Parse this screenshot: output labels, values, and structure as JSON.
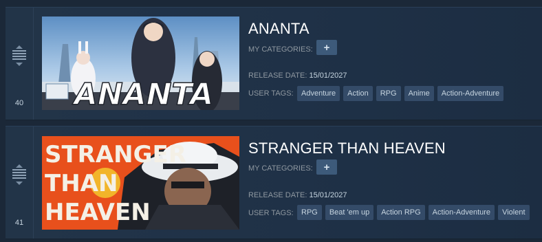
{
  "games": [
    {
      "rank": "40",
      "title": "ANANTA",
      "categories_label": "MY CATEGORIES:",
      "add_category_label": "+",
      "release_label": "RELEASE DATE:",
      "release_date": "15/01/2027",
      "tags_label": "USER TAGS:",
      "tags": [
        "Adventure",
        "Action",
        "RPG",
        "Anime",
        "Action-Adventure"
      ],
      "art_text": "ANANTA"
    },
    {
      "rank": "41",
      "title": "STRANGER THAN HEAVEN",
      "categories_label": "MY CATEGORIES:",
      "add_category_label": "+",
      "release_label": "RELEASE DATE:",
      "release_date": "15/01/2027",
      "tags_label": "USER TAGS:",
      "tags": [
        "RPG",
        "Beat 'em up",
        "Action RPG",
        "Action-Adventure",
        "Violent"
      ],
      "art_text_lines": [
        "STRANGER",
        "THAN",
        "HEAVEN"
      ]
    }
  ],
  "colors": {
    "background": "#1b2838",
    "row": "#223448",
    "tag": "#344b68",
    "add_button": "#3d5a7a",
    "label": "#8f98a0",
    "value": "#c6d4df"
  }
}
